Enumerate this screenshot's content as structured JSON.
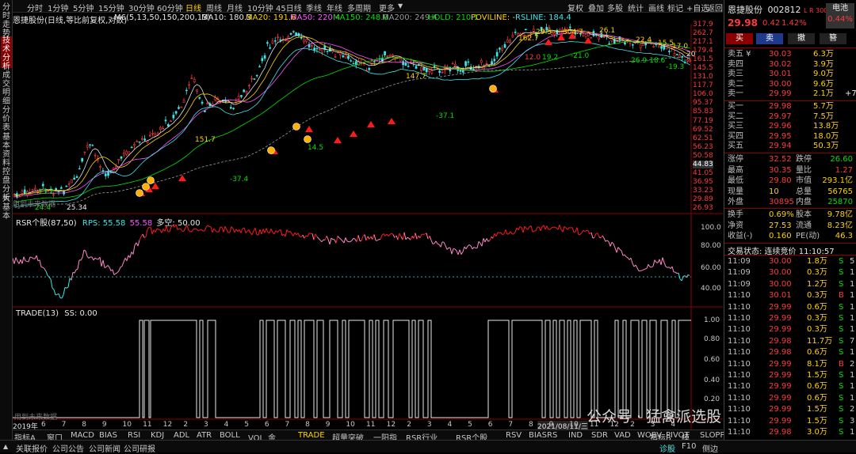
{
  "left_tabs": [
    "分时走势",
    "技术分析",
    "成交明细",
    "分价表",
    "基本资料",
    "控盘分析",
    "大基本"
  ],
  "period_tabs": [
    "分时",
    "1分钟",
    "5分钟",
    "15分钟",
    "30分钟",
    "60分钟",
    "日线",
    "周线",
    "月线",
    "10分钟",
    "45日线",
    "季线",
    "年线",
    "多周期",
    "更多"
  ],
  "active_period": "日线",
  "top_buttons": [
    "复权",
    "叠加",
    "多股",
    "统计",
    "画线",
    "标记",
    "+自选",
    "返回"
  ],
  "indicator": {
    "name": "恩捷股份(日线,等比前复权,对数)",
    "m6": "M6(5,13,50,150,200,13)",
    "ma10": "MA10: 180.3",
    "ma20": "MA20: 191.6",
    "ma50": "MA50: 220.4",
    "ma150": "MA150: 248.0",
    "ma200": "MA200: 249.4",
    "hold": "HOLD: 210.1",
    "poviline": "POVILINE: -",
    "rsline": "RSLINE: 184.4"
  },
  "price_axis": [
    "317.9",
    "262.7",
    "217.1",
    "179.4",
    "161.5",
    "145.5",
    "131.0",
    "117.7",
    "106.0",
    "95.37",
    "85.83",
    "77.19",
    "69.52",
    "62.51",
    "56.23",
    "50.58",
    "44.83",
    "41.05",
    "36.95",
    "33.23",
    "29.89",
    "26.93"
  ],
  "price_axis_highlight": "44.83",
  "chart_annotations": [
    "25.34",
    "24.4",
    "13.2",
    "151.7",
    "14.5",
    "-37.4",
    "147.7",
    "-37.1",
    "162.7",
    "29.5",
    "304.7",
    "26.1",
    "22.4",
    "15.5",
    "17.0",
    "-21.0",
    "26.9",
    "-18.6",
    "-19.3",
    "20",
    "12.0",
    "19.2"
  ],
  "rps": {
    "title": "RSR个股(87,50)",
    "rps_label": "RPS: 55.58",
    "val": "55.58",
    "duokong": "多空: 50.00",
    "axis": [
      "100.0",
      "80.00",
      "60.00",
      "40.00"
    ]
  },
  "trade": {
    "title": "TRADE(13)",
    "ss": "SS: 0.00",
    "axis": [
      "1.00",
      "0.80",
      "0.60",
      "0.40",
      "0.20"
    ],
    "watermark": "用到未来数据"
  },
  "pane_watermark": "用到未来数据",
  "time_axis": {
    "start": "2019年",
    "months": [
      "6",
      "7",
      "8",
      "9",
      "10",
      "11",
      "12",
      "2",
      "3",
      "4",
      "5",
      "6",
      "7",
      "8",
      "9",
      "10",
      "11",
      "12",
      "2",
      "3",
      "4",
      "5",
      "6",
      "7",
      "8",
      "9",
      "10",
      "11",
      "12",
      "2",
      "3",
      "4"
    ],
    "highlight": "2021/08/11/三"
  },
  "bottom_tabs": [
    "指标A",
    "窗口",
    "MACD",
    "BIAS",
    "RSI",
    "KDJ",
    "ADL",
    "ATR",
    "BOLL",
    "VOL_金",
    "TRADE",
    "超量突破",
    "一阳指",
    "RSR行业",
    "RSR个股",
    "RSV",
    "BIASRS",
    "IND",
    "SDR",
    "VAD",
    "WOBV",
    "PIVOT",
    "SLOPP",
    "更多",
    "设置"
  ],
  "active_bottom_tab": "TRADE",
  "bottom_right": [
    "指标B",
    "模",
    "板"
  ],
  "status_bar": [
    "关联报价",
    "公司公告",
    "公司新闻",
    "公司研报",
    "诊股",
    "F10",
    "侧边"
  ],
  "watermark": "公众号 · 猛禽派选股",
  "stock": {
    "name": "恩捷股份",
    "code": "002812",
    "tags": "L R 300",
    "sector": "电池",
    "sector_change": "0.44%",
    "price": "29.98",
    "change": "0.42",
    "pct": "1.42%"
  },
  "actions": [
    "买",
    "卖",
    "撤",
    "簪"
  ],
  "asks": [
    [
      "卖五 ¥",
      "30.03",
      "6.3万"
    ],
    [
      "卖四",
      "30.02",
      "3.9万"
    ],
    [
      "卖三",
      "30.01",
      "9.0万"
    ],
    [
      "卖二",
      "30.00",
      "9.6万"
    ],
    [
      "卖一",
      "29.99",
      "2.1万",
      "+7"
    ]
  ],
  "bids": [
    [
      "买一",
      "29.98",
      "5.7万"
    ],
    [
      "买二",
      "29.97",
      "7.5万"
    ],
    [
      "买三",
      "29.96",
      "13.8万"
    ],
    [
      "买四",
      "29.95",
      "18.0万"
    ],
    [
      "买五",
      "29.94",
      "50.3万"
    ]
  ],
  "stats": [
    [
      "涨停",
      "32.52",
      "跌停",
      "26.60"
    ],
    [
      "最高",
      "30.35",
      "量比",
      "1.27"
    ],
    [
      "最低",
      "29.80",
      "市值",
      "293.1亿"
    ],
    [
      "现量",
      "10",
      "总量",
      "56765"
    ],
    [
      "外盘",
      "30895",
      "内盘",
      "25870"
    ]
  ],
  "stats2": [
    [
      "换手",
      "0.69%",
      "股本",
      "9.78亿"
    ],
    [
      "净资",
      "27.53",
      "流通",
      "8.23亿"
    ],
    [
      "收益(-)",
      "0.160",
      "PE(动)",
      "46.3"
    ]
  ],
  "trade_status": "交易状态: 连续竞价 11:10:57",
  "ticks": [
    [
      "11:09",
      "30.00",
      "1.8万",
      "S",
      "5"
    ],
    [
      "11:09",
      "30.00",
      "0.3万",
      "S",
      "1"
    ],
    [
      "11:09",
      "30.00",
      "1.2万",
      "S",
      "1"
    ],
    [
      "11:10",
      "30.01",
      "0.3万",
      "B",
      "1"
    ],
    [
      "11:10",
      "29.99",
      "0.6万",
      "S",
      "1"
    ],
    [
      "11:10",
      "29.99",
      "0.3万",
      "S",
      "1"
    ],
    [
      "11:10",
      "29.99",
      "0.3万",
      "S",
      "1"
    ],
    [
      "11:10",
      "29.98",
      "11.7万",
      "S",
      "7"
    ],
    [
      "11:10",
      "29.98",
      "0.6万",
      "S",
      "1"
    ],
    [
      "11:10",
      "29.99",
      "8.1万",
      "B",
      "2"
    ],
    [
      "11:10",
      "29.99",
      "1.5万",
      "S",
      "1"
    ],
    [
      "11:10",
      "29.99",
      "0.6万",
      "S",
      "1"
    ],
    [
      "11:10",
      "29.99",
      "0.6万",
      "S",
      "1"
    ],
    [
      "11:10",
      "29.99",
      "1.5万",
      "S",
      "2"
    ],
    [
      "11:10",
      "29.99",
      "1.5万",
      "S",
      "3"
    ],
    [
      "11:10",
      "29.98",
      "3.0万",
      "S",
      "1"
    ]
  ]
}
